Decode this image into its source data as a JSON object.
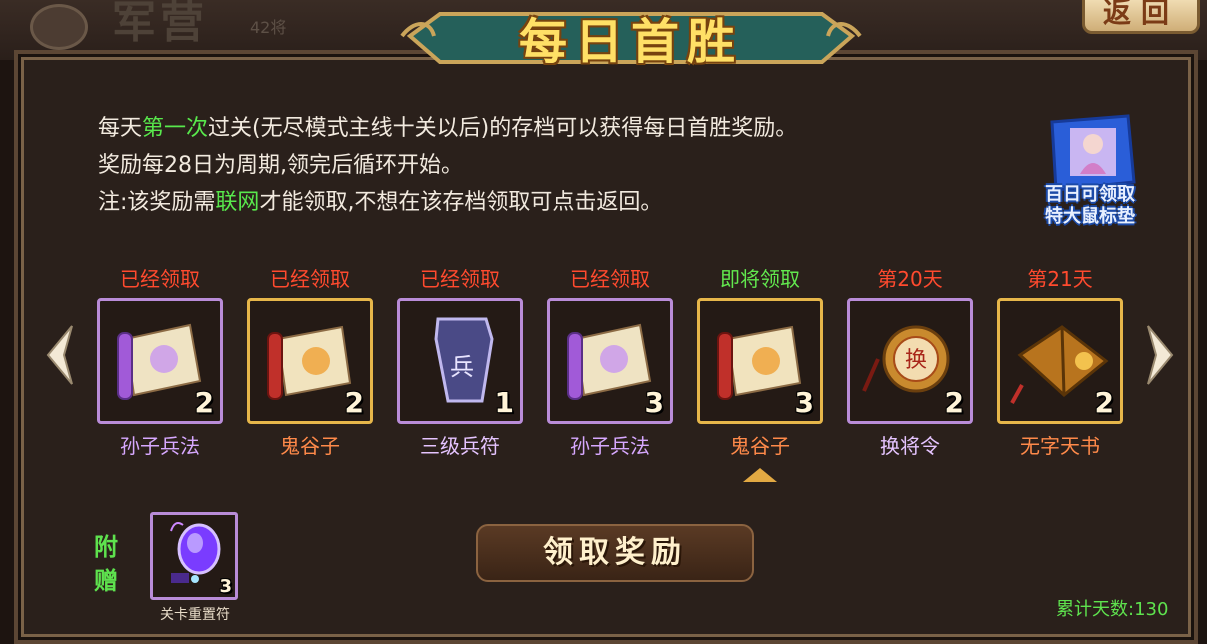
{
  "background": {
    "title": "军营",
    "count": "42将",
    "back_button": "返回"
  },
  "dialog": {
    "title": "每日首胜",
    "description": {
      "line1": {
        "pre": "每天",
        "highlight": "第一次",
        "post": "过关(无尽模式主线十关以后)的存档可以获得每日首胜奖励。"
      },
      "line2": "奖励每28日为周期,领完后循环开始。",
      "line3": {
        "pre": "注:该奖励需",
        "highlight": "联网",
        "post": "才能领取,不想在该存档领取可点击返回。"
      }
    },
    "promo": {
      "line1": "百日可领取",
      "line2": "特大鼠标垫"
    },
    "days": [
      {
        "status": "已经领取",
        "item": "孙子兵法",
        "qty": "2",
        "frame": "purple",
        "icon": "scroll-purple-icon"
      },
      {
        "status": "已经领取",
        "item": "鬼谷子",
        "qty": "2",
        "frame": "gold",
        "icon": "scroll-gold-icon"
      },
      {
        "status": "已经领取",
        "item": "三级兵符",
        "qty": "1",
        "frame": "purple",
        "icon": "tally-icon"
      },
      {
        "status": "已经领取",
        "item": "孙子兵法",
        "qty": "3",
        "frame": "purple",
        "icon": "scroll-purple-icon"
      },
      {
        "status": "即将领取",
        "item": "鬼谷子",
        "qty": "3",
        "frame": "gold",
        "icon": "scroll-gold-icon"
      },
      {
        "status": "第20天",
        "item": "换将令",
        "qty": "2",
        "frame": "purple",
        "icon": "token-icon"
      },
      {
        "status": "第21天",
        "item": "无字天书",
        "qty": "2",
        "frame": "gold",
        "icon": "book-icon"
      }
    ],
    "bonus": {
      "label_line1": "附",
      "label_line2": "赠",
      "item": "关卡重置符",
      "qty": "3",
      "icon": "gem-icon"
    },
    "claim_button": "领取奖励",
    "total_days": "累计天数:130"
  },
  "colors": {
    "claimed": "#ff4a2e",
    "upcoming": "#62e84e",
    "future": "#ff4a2e",
    "purple_frame": "#b98cd8",
    "gold_frame": "#e6b64a"
  }
}
